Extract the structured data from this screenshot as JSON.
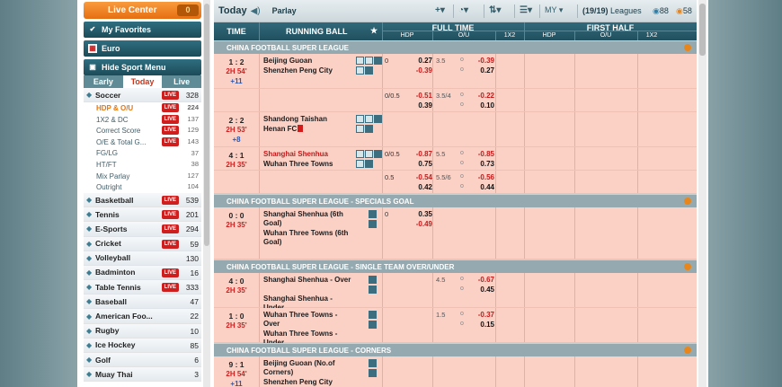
{
  "sidebar": {
    "live_center": {
      "label": "Live Center",
      "count": "0"
    },
    "my_favorites": "My Favorites",
    "euro": "Euro",
    "hide_sport_menu": "Hide Sport Menu",
    "tabs": [
      "Early",
      "Today",
      "Live"
    ],
    "active_tab": "Today",
    "sports": [
      {
        "name": "Soccer",
        "live": "LIVE",
        "count": "328"
      },
      {
        "name": "Basketball",
        "live": "LIVE",
        "count": "539"
      },
      {
        "name": "Tennis",
        "live": "LIVE",
        "count": "201"
      },
      {
        "name": "E-Sports",
        "live": "LIVE",
        "count": "294"
      },
      {
        "name": "Cricket",
        "live": "LIVE",
        "count": "59"
      },
      {
        "name": "Volleyball",
        "live": "",
        "count": "130"
      },
      {
        "name": "Badminton",
        "live": "LIVE",
        "count": "16"
      },
      {
        "name": "Table Tennis",
        "live": "LIVE",
        "count": "333"
      },
      {
        "name": "Baseball",
        "live": "",
        "count": "47"
      },
      {
        "name": "American Foo...",
        "live": "",
        "count": "22"
      },
      {
        "name": "Rugby",
        "live": "",
        "count": "10"
      },
      {
        "name": "Ice Hockey",
        "live": "",
        "count": "85"
      },
      {
        "name": "Golf",
        "live": "",
        "count": "6"
      },
      {
        "name": "Muay Thai",
        "live": "",
        "count": "3"
      }
    ],
    "soccer_subs": [
      {
        "name": "HDP & O/U",
        "live": "LIVE",
        "count": "224",
        "selected": true
      },
      {
        "name": "1X2 & DC",
        "live": "LIVE",
        "count": "137"
      },
      {
        "name": "Correct Score",
        "live": "LIVE",
        "count": "129"
      },
      {
        "name": "O/E & Total G...",
        "live": "LIVE",
        "count": "143"
      },
      {
        "name": "FG/LG",
        "live": "",
        "count": "37"
      },
      {
        "name": "HT/FT",
        "live": "",
        "count": "38"
      },
      {
        "name": "Mix Parlay",
        "live": "",
        "count": "127"
      },
      {
        "name": "Outright",
        "live": "",
        "count": "104"
      }
    ]
  },
  "topbar": {
    "title": "Today",
    "parlay": "Parlay",
    "odds_type": "MY",
    "leagues_count": "(19/19)",
    "leagues_label": "Leagues",
    "count_a": "88",
    "count_b": "58"
  },
  "table_header": {
    "time": "TIME",
    "running_ball": "RUNNING BALL",
    "full_time": "FULL TIME",
    "first_half": "FIRST HALF",
    "hdp": "HDP",
    "ou": "O/U",
    "x12": "1X2"
  },
  "sections": [
    {
      "league": "CHINA FOOTBALL SUPER LEAGUE",
      "matches": [
        {
          "score": "1 : 2",
          "time": "2H 54'",
          "more": "+11",
          "home": "Beijing Guoan",
          "away": "Shenzhen Peng City",
          "rows": [
            {
              "hdp": "0",
              "h1": "0.27",
              "h2": "-0.39",
              "ou": "3.5",
              "o1": "-0.39",
              "o2": "0.27"
            },
            {
              "hdp": "0/0.5",
              "h1": "-0.51",
              "h2": "0.39",
              "ou": "3.5/4",
              "o1": "-0.22",
              "o2": "0.10"
            }
          ]
        },
        {
          "score": "2 : 2",
          "time": "2H 53'",
          "more": "+8",
          "home": "Shandong Taishan",
          "away": "Henan FC",
          "rows": []
        },
        {
          "score": "4 : 1",
          "time": "2H 35'",
          "more": "",
          "home": "Shanghai Shenhua",
          "away": "Wuhan Three Towns",
          "rows": [
            {
              "hdp": "0/0.5",
              "h1": "-0.87",
              "h2": "0.75",
              "ou": "5.5",
              "o1": "-0.85",
              "o2": "0.73"
            },
            {
              "hdp": "0.5",
              "h1": "-0.54",
              "h2": "0.42",
              "ou": "5.5/6",
              "o1": "-0.56",
              "o2": "0.44"
            }
          ]
        }
      ]
    },
    {
      "league": "CHINA FOOTBALL SUPER LEAGUE - SPECIALS GOAL",
      "matches": [
        {
          "score": "0 : 0",
          "time": "2H 35'",
          "home": "Shanghai Shenhua (6th Goal)",
          "away": "Wuhan Three Towns (6th Goal)",
          "rows": [
            {
              "hdp": "0",
              "h1": "0.35",
              "h2": "-0.49"
            }
          ]
        }
      ]
    },
    {
      "league": "CHINA FOOTBALL SUPER LEAGUE - SINGLE TEAM OVER/UNDER",
      "matches": [
        {
          "score": "4 : 0",
          "time": "2H 35'",
          "home": "Shanghai Shenhua - Over",
          "away": "Shanghai Shenhua - Under",
          "rows": [
            {
              "ou": "4.5",
              "o1": "-0.67",
              "o2": "0.45"
            }
          ]
        },
        {
          "score": "1 : 0",
          "time": "2H 35'",
          "home": "Wuhan Three Towns - Over",
          "away": "Wuhan Three Towns - Under",
          "rows": [
            {
              "ou": "1.5",
              "o1": "-0.37",
              "o2": "0.15"
            }
          ]
        }
      ]
    },
    {
      "league": "CHINA FOOTBALL SUPER LEAGUE - CORNERS",
      "matches": [
        {
          "score": "9 : 1",
          "time": "2H 54'",
          "more": "+11",
          "home": "Beijing Guoan (No.of Corners)",
          "away": "Shenzhen Peng City (No.of Corners)"
        }
      ]
    }
  ],
  "ou_marker": "o",
  "colors": {
    "accent_orange": "#e56f12",
    "header_teal": "#20505f",
    "live_red": "#cf1e1e",
    "odds_neg": "#c51a1a",
    "row_pink": "#fbd1c6"
  }
}
